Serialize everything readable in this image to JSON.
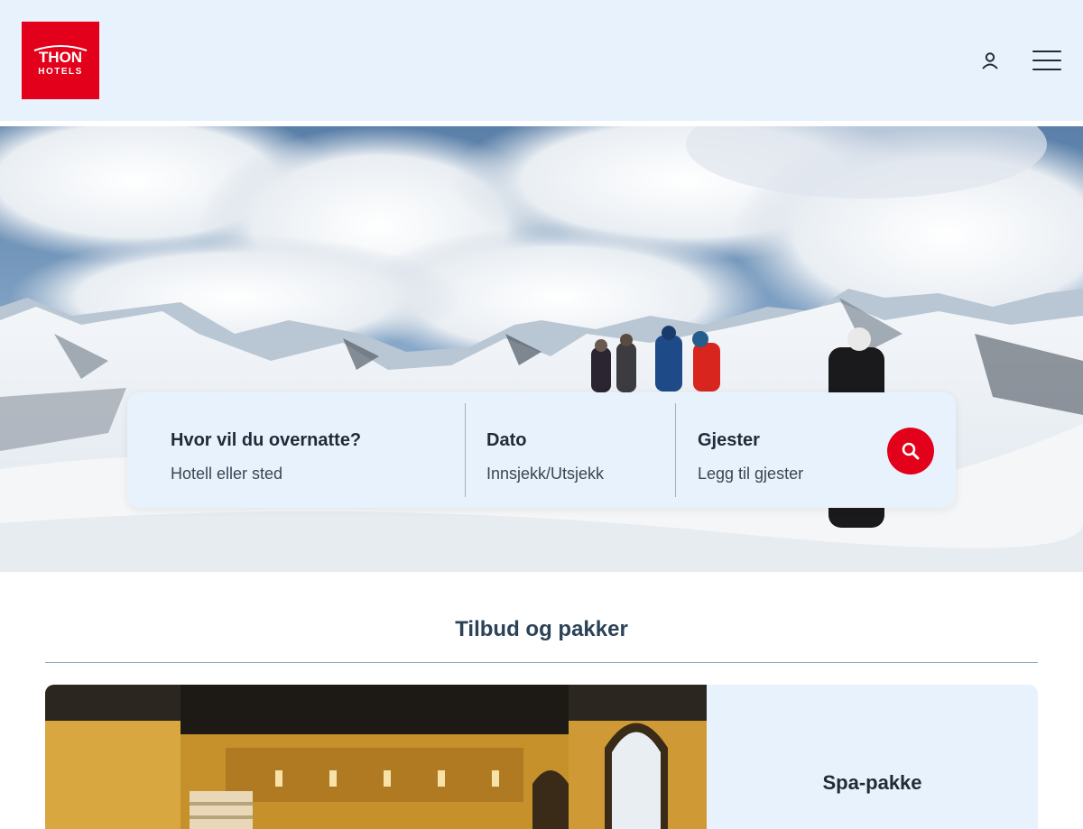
{
  "brand": {
    "name_line1": "THON",
    "name_line2": "HOTELS",
    "color": "#e2001a"
  },
  "header": {
    "user_icon": "user-icon",
    "menu_icon": "hamburger-menu-icon"
  },
  "search": {
    "destination": {
      "label": "Hvor vil du overnatte?",
      "placeholder": "Hotell eller sted"
    },
    "date": {
      "label": "Dato",
      "placeholder": "Innsjekk/Utsjekk"
    },
    "guests": {
      "label": "Gjester",
      "placeholder": "Legg til gjester"
    },
    "button_icon": "search-icon"
  },
  "offers": {
    "title": "Tilbud og pakker",
    "cards": [
      {
        "title": "Spa-pakke"
      }
    ]
  },
  "colors": {
    "accent": "#e2001a",
    "panel": "#e8f2fc",
    "text": "#1f2b38"
  }
}
